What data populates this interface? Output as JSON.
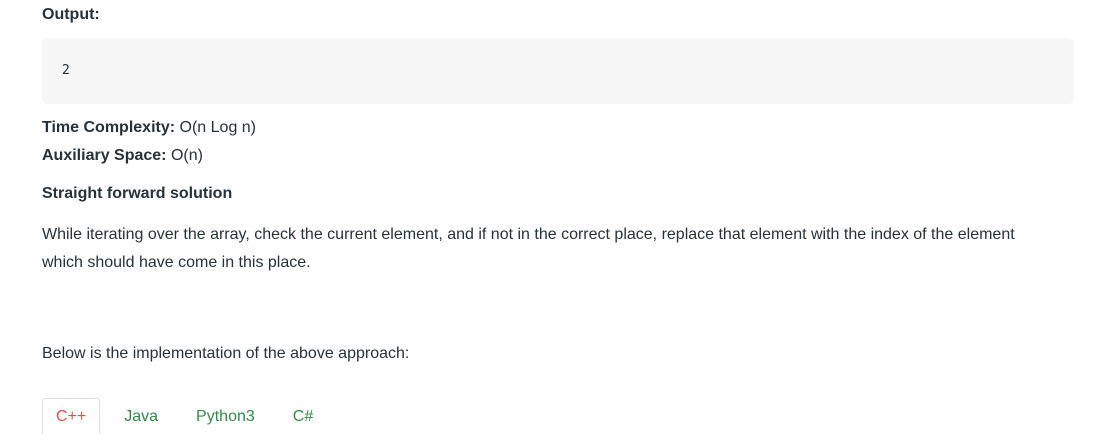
{
  "output": {
    "label": "Output:",
    "value": "2"
  },
  "complexity": {
    "time_key": "Time Complexity:",
    "time_value": " O(n Log n)",
    "space_key": "Auxiliary Space:",
    "space_value": " O(n)"
  },
  "section": {
    "heading": "Straight forward solution",
    "paragraph": "While iterating over the array, check the current element, and if not in the correct place, replace that element with the index of the element which should have come in this place.",
    "implementation_intro": "Below is the implementation of the above approach:"
  },
  "tabs": [
    {
      "label": "C++",
      "active": true
    },
    {
      "label": "Java",
      "active": false
    },
    {
      "label": "Python3",
      "active": false
    },
    {
      "label": "C#",
      "active": false
    }
  ],
  "colors": {
    "text": "#273239",
    "active_tab": "#e0523a",
    "tab_link": "#2f8d46",
    "code_bg": "#f7f7f7"
  }
}
